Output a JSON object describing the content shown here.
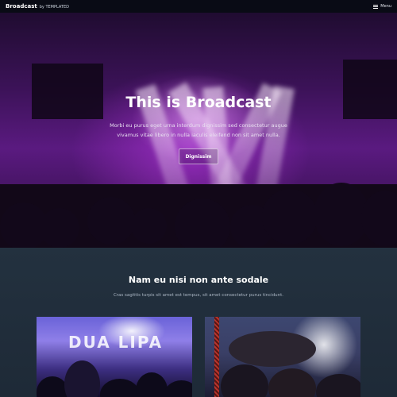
{
  "nav": {
    "brand": "Broadcast",
    "brand_by": "by TEMPLATED",
    "menu_label": "Menu",
    "menu_icon": "hamburger-icon"
  },
  "hero": {
    "title": "This is Broadcast",
    "text": "Morbi eu purus eget urna interdum dignissim sed consectetur augue vivamus vitae libero in nulla iaculis eleifend non sit amet nulla.",
    "button_label": "Dignissim"
  },
  "section": {
    "title": "Nam eu nisi non ante sodale",
    "text": "Cras sagittis turpis sit amet est tempus, sit amet consectetur purus tincidunt.",
    "cards": [
      {
        "image": "concert-stage-image",
        "stage_text": "DUA LIPA"
      },
      {
        "image": "crowd-surfing-image"
      }
    ]
  },
  "colors": {
    "hero_purple": "#5a1a80",
    "section_bg": "#23313f",
    "nav_bg": "#080c14"
  }
}
